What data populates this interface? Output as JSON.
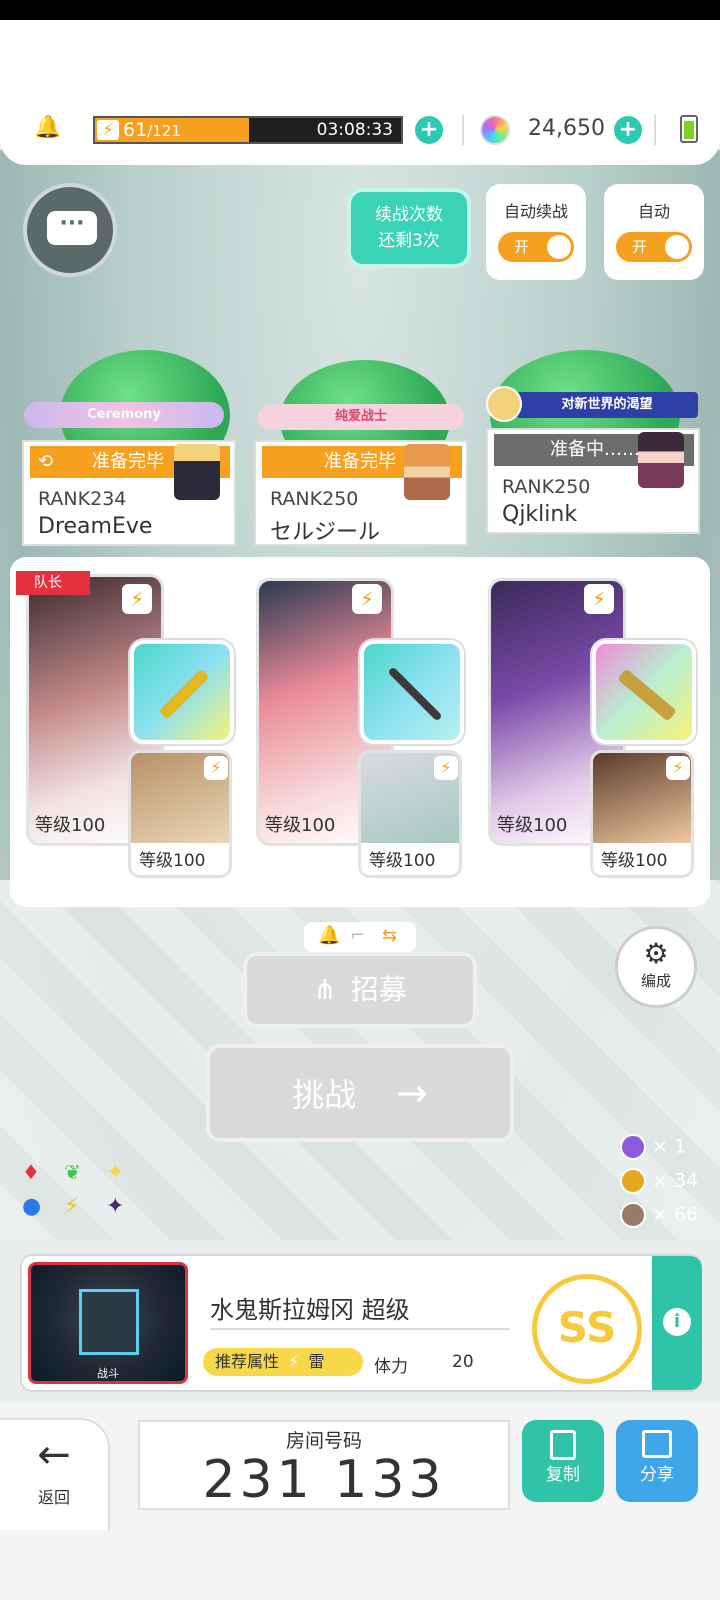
{
  "header": {
    "stamina_current": "61",
    "stamina_max": "/121",
    "stamina_fraction": 0.504,
    "stamina_timer": "03:08:33",
    "gem_count": "24,650"
  },
  "chat": {
    "icon": "chat-bubble-icon",
    "glyph": "···"
  },
  "auto": {
    "retry_line1": "续战次数",
    "retry_line2": "还剩3次",
    "auto_retry_label": "自动续战",
    "auto_retry_state": "开",
    "auto_label": "自动",
    "auto_state": "开"
  },
  "players": [
    {
      "banner": "Ceremony",
      "status": "准备完毕",
      "rank": "RANK234",
      "name": "DreamEve"
    },
    {
      "banner": "纯爱战士",
      "status": "准备完毕",
      "rank": "RANK250",
      "name": "セルジール"
    },
    {
      "banner": "对新世界的渴望",
      "status": "准备中……",
      "rank": "RANK250",
      "name": "Qjklink"
    }
  ],
  "team": {
    "leader_tag": "队长",
    "members": [
      {
        "level": "等级100",
        "support_level": "等级100"
      },
      {
        "level": "等级100",
        "support_level": "等级100"
      },
      {
        "level": "等级100",
        "support_level": "等级100"
      }
    ]
  },
  "buttons": {
    "recruit": "招募",
    "challenge": "挑战",
    "edit": "编成"
  },
  "drops": [
    {
      "count": "× 1",
      "color": "#8e5ad8"
    },
    {
      "count": "× 34",
      "color": "#e2a81e"
    },
    {
      "count": "× 66",
      "color": "#9a7a66"
    }
  ],
  "quest": {
    "image_caption": "战斗",
    "name": "水鬼斯拉姆冈 超级",
    "recommended_label": "推荐属性",
    "element": "雷",
    "stamina_label": "体力",
    "stamina_cost": "20",
    "grade": "SS"
  },
  "footer": {
    "back_label": "返回",
    "room_label": "房间号码",
    "room_number": "231 133",
    "copy_label": "复制",
    "share_label": "分享"
  },
  "colors": {
    "accent_teal": "#2fc4a8",
    "accent_orange": "#f6a020",
    "share_blue": "#3fa6ea"
  }
}
